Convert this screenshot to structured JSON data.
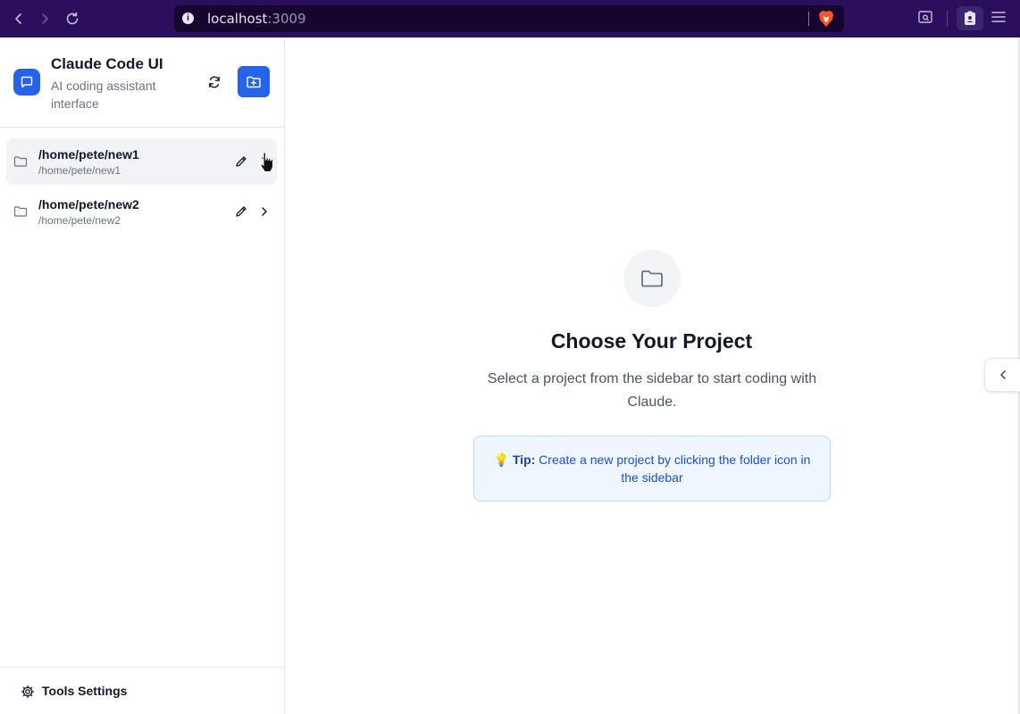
{
  "browser": {
    "url_host": "localhost",
    "url_port": ":3009",
    "icons": [
      "back-icon",
      "forward-icon",
      "reload-icon",
      "info-icon",
      "brave-lion-icon",
      "screenshot-icon",
      "wallet-icon",
      "menu-icon"
    ]
  },
  "sidebar": {
    "title": "Claude Code UI",
    "subtitle": "AI coding assistant interface",
    "projects": [
      {
        "name": "/home/pete/new1",
        "path": "/home/pete/new1",
        "active": true
      },
      {
        "name": "/home/pete/new2",
        "path": "/home/pete/new2",
        "active": false
      }
    ],
    "footer_label": "Tools Settings"
  },
  "main": {
    "title": "Choose Your Project",
    "description": "Select a project from the sidebar to start coding with Claude.",
    "tip_emoji": "💡",
    "tip_label": "Tip:",
    "tip_text": "Create a new project by clicking the folder icon in the sidebar"
  },
  "colors": {
    "accent": "#2563eb",
    "browser_bar": "#2b0f5c",
    "tip_background": "#eff6ff",
    "tip_text": "#1d4ed8"
  }
}
